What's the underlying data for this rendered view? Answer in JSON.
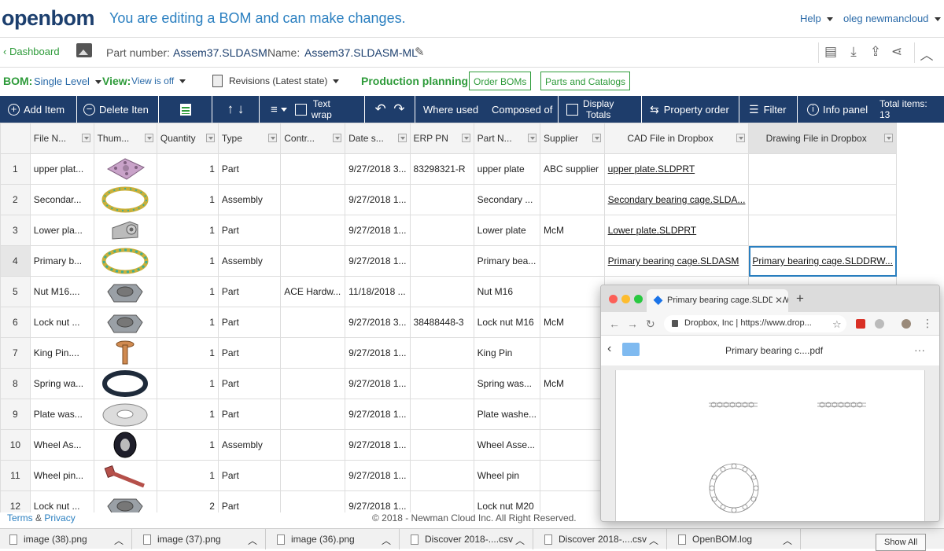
{
  "header": {
    "logo": "openbom",
    "editing_msg": "You are editing a BOM and can make changes.",
    "help": "Help",
    "user": "oleg newmancloud"
  },
  "partbar": {
    "dashboard": "Dashboard",
    "part_number_label": "Part number:",
    "part_number": "Assem37.SLDASM",
    "name_label": "Name:",
    "name": "Assem37.SLDASM-ML"
  },
  "optbar": {
    "bom_label": "BOM:",
    "bom_value": "Single Level",
    "view_label": "View:",
    "view_value": "View is off",
    "revisions": "Revisions (Latest state)",
    "pp_label": "Production planning:",
    "order_boms": "Order BOMs",
    "parts_catalogs": "Parts and Catalogs"
  },
  "toolbar": {
    "add_item": "Add Item",
    "delete_item": "Delete Iten",
    "text_wrap_1": "Text",
    "text_wrap_2": "wrap",
    "where_used": "Where used",
    "composed_of": "Composed of",
    "display_totals_1": "Display",
    "display_totals_2": "Totals",
    "property_order": "Property order",
    "filter": "Filter",
    "info_panel": "Info panel",
    "total_items_label": "Total items:",
    "total_items": "13"
  },
  "table": {
    "columns": [
      "File N...",
      "Thum...",
      "Quantity",
      "Type",
      "Contr...",
      "Date s...",
      "ERP PN",
      "Part N...",
      "Supplier",
      "CAD File in Dropbox",
      "Drawing File in Dropbox"
    ],
    "rows": [
      {
        "n": "1",
        "file": "upper plat...",
        "thumb": "plate",
        "qty": "1",
        "type": "Part",
        "contr": "",
        "date": "9/27/2018 3...",
        "erp": "83298321-R",
        "part": "upper plate",
        "supplier": "ABC supplier",
        "cad": "upper plate.SLDPRT",
        "drw": ""
      },
      {
        "n": "2",
        "file": "Secondar...",
        "thumb": "ring-yellow",
        "qty": "1",
        "type": "Assembly",
        "contr": "",
        "date": "9/27/2018 1...",
        "erp": "",
        "part": "Secondary ...",
        "supplier": "",
        "cad": "Secondary bearing cage.SLDA...",
        "drw": ""
      },
      {
        "n": "3",
        "file": "Lower pla...",
        "thumb": "bracket",
        "qty": "1",
        "type": "Part",
        "contr": "",
        "date": "9/27/2018 1...",
        "erp": "",
        "part": "Lower plate",
        "supplier": "McM",
        "cad": "Lower plate.SLDPRT",
        "drw": ""
      },
      {
        "n": "4",
        "file": "Primary b...",
        "thumb": "ring-green",
        "qty": "1",
        "type": "Assembly",
        "contr": "",
        "date": "9/27/2018 1...",
        "erp": "",
        "part": "Primary bea...",
        "supplier": "",
        "cad": "Primary bearing cage.SLDASM",
        "drw": "Primary bearing cage.SLDDRW..."
      },
      {
        "n": "5",
        "file": "Nut M16....",
        "thumb": "nut",
        "qty": "1",
        "type": "Part",
        "contr": "ACE Hardw...",
        "date": "11/18/2018 ...",
        "erp": "",
        "part": "Nut M16",
        "supplier": "",
        "cad": "",
        "drw": ""
      },
      {
        "n": "6",
        "file": "Lock nut ...",
        "thumb": "nut",
        "qty": "1",
        "type": "Part",
        "contr": "",
        "date": "9/27/2018 3...",
        "erp": "38488448-3",
        "part": "Lock nut M16",
        "supplier": "McM",
        "cad": "",
        "drw": ""
      },
      {
        "n": "7",
        "file": "King Pin....",
        "thumb": "pin",
        "qty": "1",
        "type": "Part",
        "contr": "",
        "date": "9/27/2018 1...",
        "erp": "",
        "part": "King Pin",
        "supplier": "",
        "cad": "",
        "drw": ""
      },
      {
        "n": "8",
        "file": "Spring wa...",
        "thumb": "ring-black",
        "qty": "1",
        "type": "Part",
        "contr": "",
        "date": "9/27/2018 1...",
        "erp": "",
        "part": "Spring was...",
        "supplier": "McM",
        "cad": "",
        "drw": ""
      },
      {
        "n": "9",
        "file": "Plate was...",
        "thumb": "washer",
        "qty": "1",
        "type": "Part",
        "contr": "",
        "date": "9/27/2018 1...",
        "erp": "",
        "part": "Plate washe...",
        "supplier": "",
        "cad": "",
        "drw": ""
      },
      {
        "n": "10",
        "file": "Wheel As...",
        "thumb": "wheel",
        "qty": "1",
        "type": "Assembly",
        "contr": "",
        "date": "9/27/2018 1...",
        "erp": "",
        "part": "Wheel Asse...",
        "supplier": "",
        "cad": "",
        "drw": ""
      },
      {
        "n": "11",
        "file": "Wheel pin...",
        "thumb": "bolt",
        "qty": "1",
        "type": "Part",
        "contr": "",
        "date": "9/27/2018 1...",
        "erp": "",
        "part": "Wheel pin",
        "supplier": "",
        "cad": "",
        "drw": ""
      },
      {
        "n": "12",
        "file": "Lock nut ...",
        "thumb": "nut",
        "qty": "2",
        "type": "Part",
        "contr": "",
        "date": "9/27/2018 1...",
        "erp": "",
        "part": "Lock nut M20",
        "supplier": "",
        "cad": "",
        "drw": ""
      }
    ]
  },
  "footer": {
    "terms": "Terms",
    "amp": "&",
    "privacy": "Privacy",
    "copyright": "© 2018 - Newman Cloud Inc. All Right Reserved."
  },
  "browser": {
    "tab_title": "Primary bearing cage.SLDDRW",
    "address_site": "Dropbox, Inc |",
    "address_url": "https://www.drop...",
    "file_name": "Primary bearing c....pdf"
  },
  "downloads": {
    "items": [
      "image (38).png",
      "image (37).png",
      "image (36).png",
      "Discover 2018-....csv",
      "Discover 2018-....csv",
      "OpenBOM.log"
    ],
    "show_all": "Show All"
  }
}
